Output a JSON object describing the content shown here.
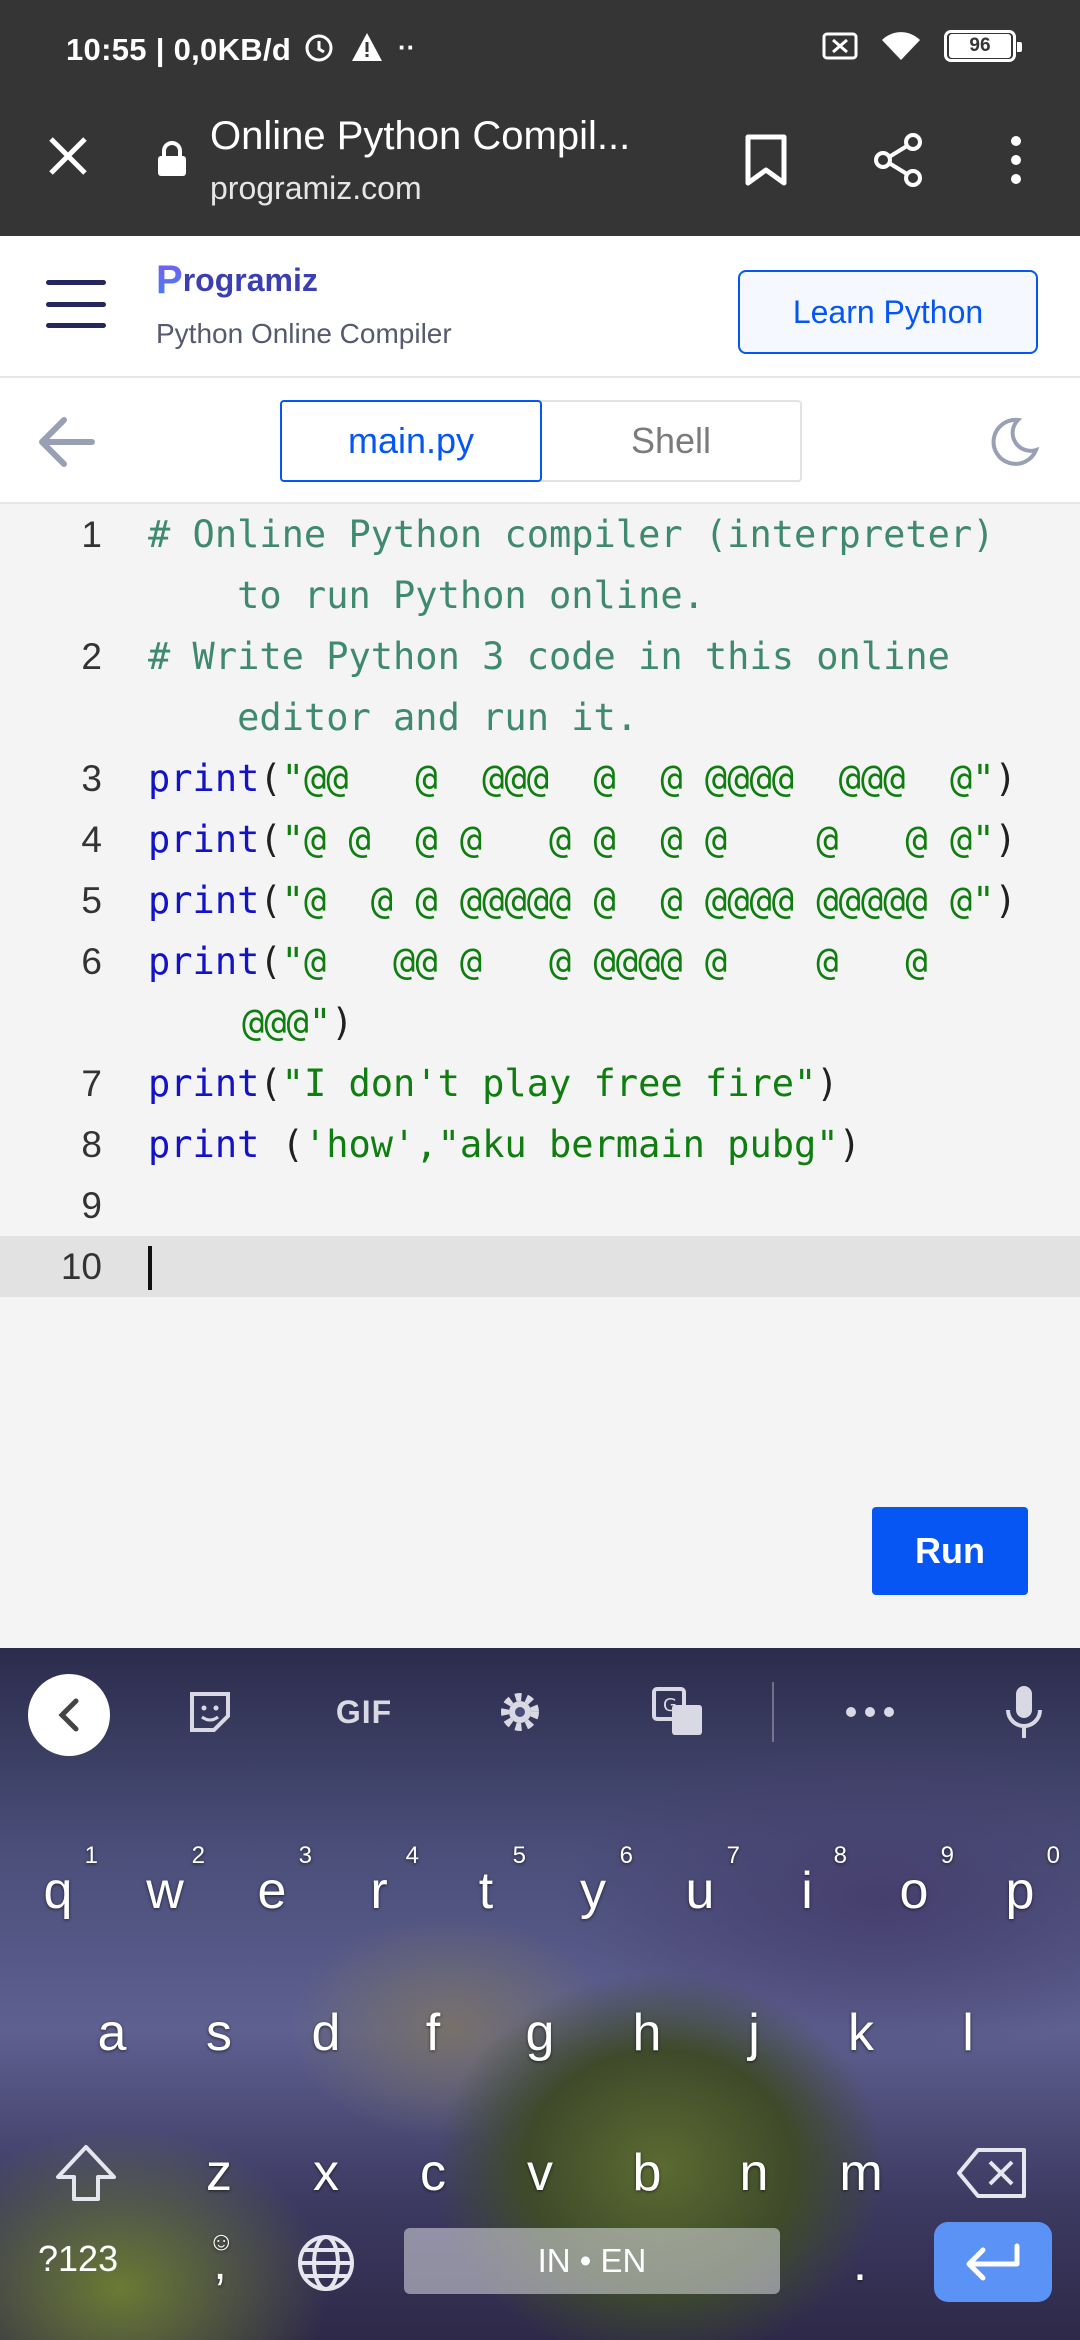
{
  "status_bar": {
    "text": "10:55 | 0,0KB/d",
    "battery": "96"
  },
  "browser": {
    "page_title": "Online Python Compil...",
    "host": "programiz.com"
  },
  "site": {
    "logo": "rogramiz",
    "logo_initial": "P",
    "subtitle": "Python Online Compiler",
    "learn_button": "Learn Python"
  },
  "tabs": {
    "main": "main.py",
    "shell": "Shell"
  },
  "editor": {
    "line_numbers": [
      "1",
      "2",
      "3",
      "4",
      "5",
      "6",
      "7",
      "8",
      "9",
      "10"
    ],
    "lines": {
      "l1a": "# Online Python compiler (interpreter)",
      "l1b": "    to run Python online.",
      "l2a": "# Write Python 3 code in this online",
      "l2b": "    editor and run it.",
      "kw": "print",
      "l3": "\"@@   @  @@@  @  @ @@@@  @@@  @\"",
      "l4": "\"@ @  @ @   @ @  @ @    @   @ @\"",
      "l5": "\"@  @ @ @@@@@ @  @ @@@@ @@@@@ @\"",
      "l6a": "\"@   @@ @   @ @@@@ @    @   @",
      "l6b": "@@@\"",
      "l7": "\"I don't play free fire\"",
      "l8_kw": "print ",
      "l8": "'how',\"aku bermain pubg\"",
      "open": "(",
      "close": ")",
      "comma_open": "("
    },
    "run_button": "Run"
  },
  "keyboard": {
    "gif": "GIF",
    "row1": [
      "q",
      "w",
      "e",
      "r",
      "t",
      "y",
      "u",
      "i",
      "o",
      "p"
    ],
    "row1_nums": [
      "1",
      "2",
      "3",
      "4",
      "5",
      "6",
      "7",
      "8",
      "9",
      "0"
    ],
    "row2": [
      "a",
      "s",
      "d",
      "f",
      "g",
      "h",
      "j",
      "k",
      "l"
    ],
    "row3": [
      "z",
      "x",
      "c",
      "v",
      "b",
      "n",
      "m"
    ],
    "symbols": "?123",
    "comma": ",",
    "space": "IN • EN",
    "period": "."
  }
}
